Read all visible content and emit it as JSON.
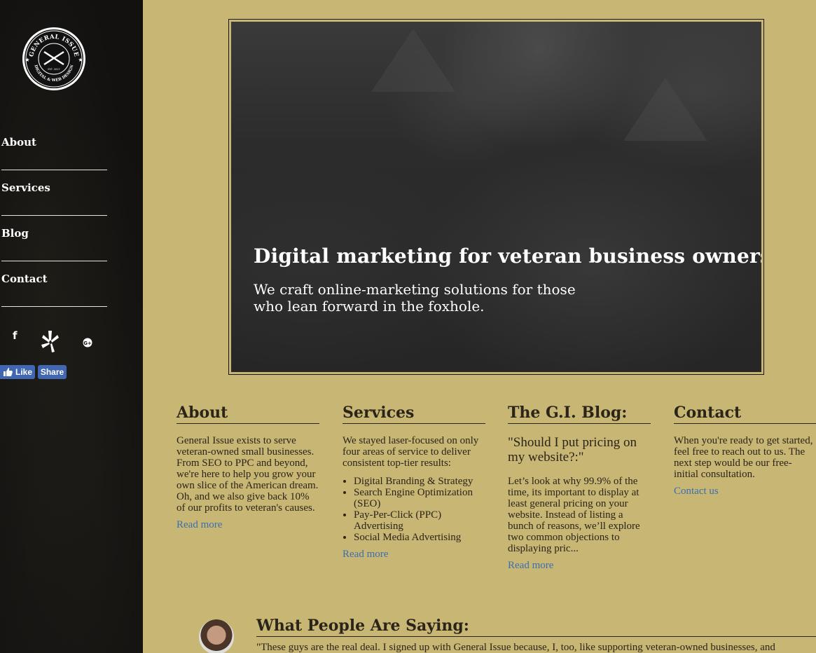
{
  "sidebar": {
    "logo": {
      "top_text": "GENERAL ISSUE",
      "bottom_text": "DIGITAL & WEB DESIGN",
      "est_text": "EST. 2017"
    },
    "nav": [
      "About",
      "Services",
      "Blog",
      "Contact"
    ],
    "social_icons": [
      "facebook-icon",
      "yelp-icon",
      "google-plus-icon"
    ],
    "fb_like_label": "Like",
    "fb_share_label": "Share"
  },
  "hero": {
    "headline": "Digital marketing for veteran business owners.",
    "subline_1": "We craft online-marketing solutions for those",
    "subline_2": "who lean forward in the foxhole."
  },
  "about": {
    "heading": "About",
    "text": "General Issue exists to serve veteran-owned small businesses. From SEO to PPC and beyond, we're here to help you grow your own slice of the American dream. Oh, and we also give back 10% of our profits to veteran's causes.",
    "link": "Read more"
  },
  "services": {
    "heading": "Services",
    "text": "We stayed laser-focused on only four areas of service to deliver consistent top-tier results:",
    "items": [
      "Digital Branding & Strategy",
      "Search Engine Optimization (SEO)",
      "Pay-Per-Click (PPC) Advertising",
      "Social Media Advertising"
    ],
    "link": "Read more"
  },
  "blog": {
    "heading": "The G.I. Blog:",
    "post_title": "\"Should I put pricing on my website?:\"",
    "excerpt": "Let’s look at why 99.9% of the time, its important to display at least general pricing on your website. Instead of listing a bunch of reasons, we’ll explore two common objections to displaying pric...",
    "link": "Read more"
  },
  "contact": {
    "heading": "Contact",
    "text": "When you're ready to get started, feel free to reach out to us. The next step would be our free-initial consultation.",
    "link": "Contact us"
  },
  "testimonials": {
    "heading": "What People Are Saying:",
    "quote": "\"These guys are the real deal. I signed up with General Issue because, I, too, like supporting veteran-owned businesses, and"
  },
  "colors": {
    "background": "#c8b674",
    "sidebar": "#121110",
    "link": "#3a6fb0",
    "facebook": "#4267b2"
  }
}
